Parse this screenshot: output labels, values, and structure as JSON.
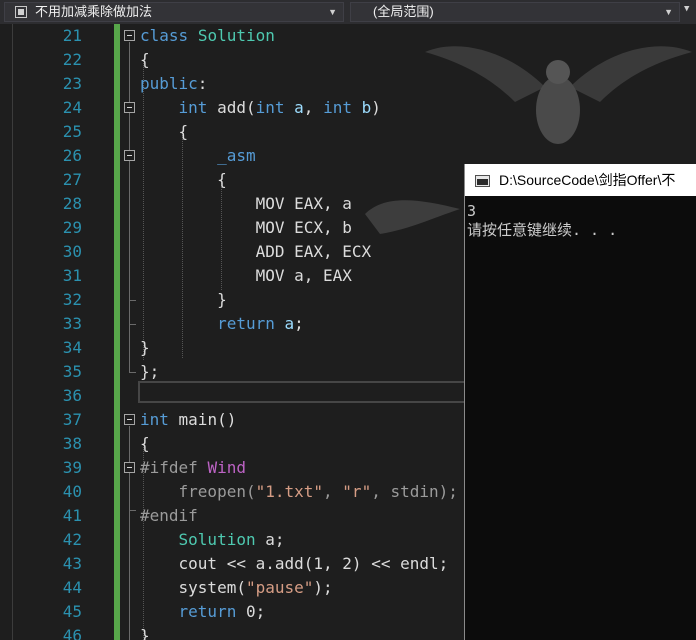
{
  "navbar": {
    "scope_label": "不用加减乘除做加法",
    "function_label": "(全局范围)"
  },
  "editor": {
    "line_numbers": [
      "21",
      "22",
      "23",
      "24",
      "25",
      "26",
      "27",
      "28",
      "29",
      "30",
      "31",
      "32",
      "33",
      "34",
      "35",
      "36",
      "37",
      "38",
      "39",
      "40",
      "41",
      "42",
      "43",
      "44",
      "45",
      "46"
    ]
  },
  "console": {
    "title": "D:\\SourceCode\\剑指Offer\\不",
    "output_line1": "3",
    "output_line2": "请按任意键继续. . ."
  },
  "colors": {
    "keyword": "#569cd6",
    "type": "#4ec9b0",
    "parameter": "#9cdcfe",
    "string": "#d69d85",
    "line_number": "#2b91af",
    "change_bar": "#57a64a"
  }
}
